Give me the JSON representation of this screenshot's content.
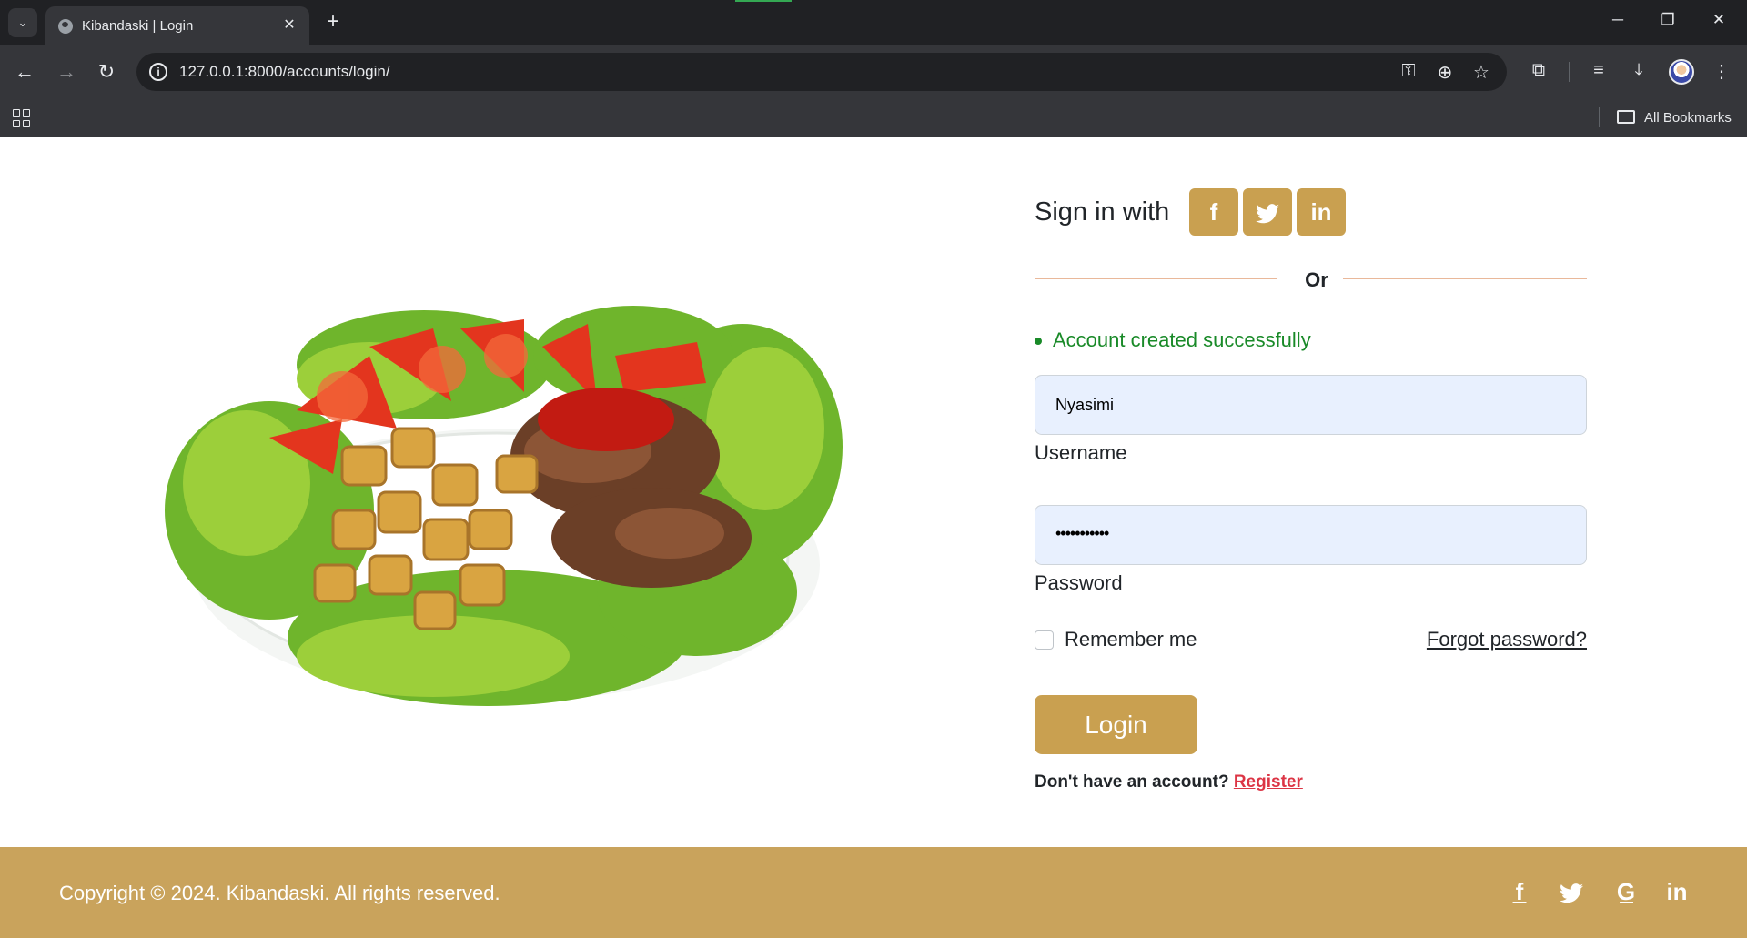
{
  "browser": {
    "tab_title": "Kibandaski | Login",
    "tab_close": "✕",
    "new_tab": "+",
    "url": "127.0.0.1:8000/accounts/login/",
    "bookmarks_label": "All Bookmarks",
    "window_controls": {
      "minimize": "─",
      "restore": "❐",
      "close": "✕"
    }
  },
  "login": {
    "sign_in_with": "Sign in with",
    "social": {
      "facebook": "f",
      "twitter": "🐦",
      "linkedin": "in"
    },
    "divider": "Or",
    "message": "Account created successfully",
    "username_value": "Nyasimi",
    "username_label": "Username",
    "password_value": "•••••••••••",
    "password_label": "Password",
    "remember_me": "Remember me",
    "forgot_password": "Forgot password?",
    "login_button": "Login",
    "no_account": "Don't have an account?",
    "register": "Register"
  },
  "footer": {
    "copyright": "Copyright © 2024. Kibandaski. All rights reserved.",
    "icons": [
      "facebook-icon",
      "twitter-icon",
      "google-icon",
      "linkedin-icon"
    ]
  },
  "colors": {
    "accent": "#c9a050",
    "footer_bg": "#c9a35c",
    "success": "#198a28",
    "register_link": "#dc3545"
  }
}
